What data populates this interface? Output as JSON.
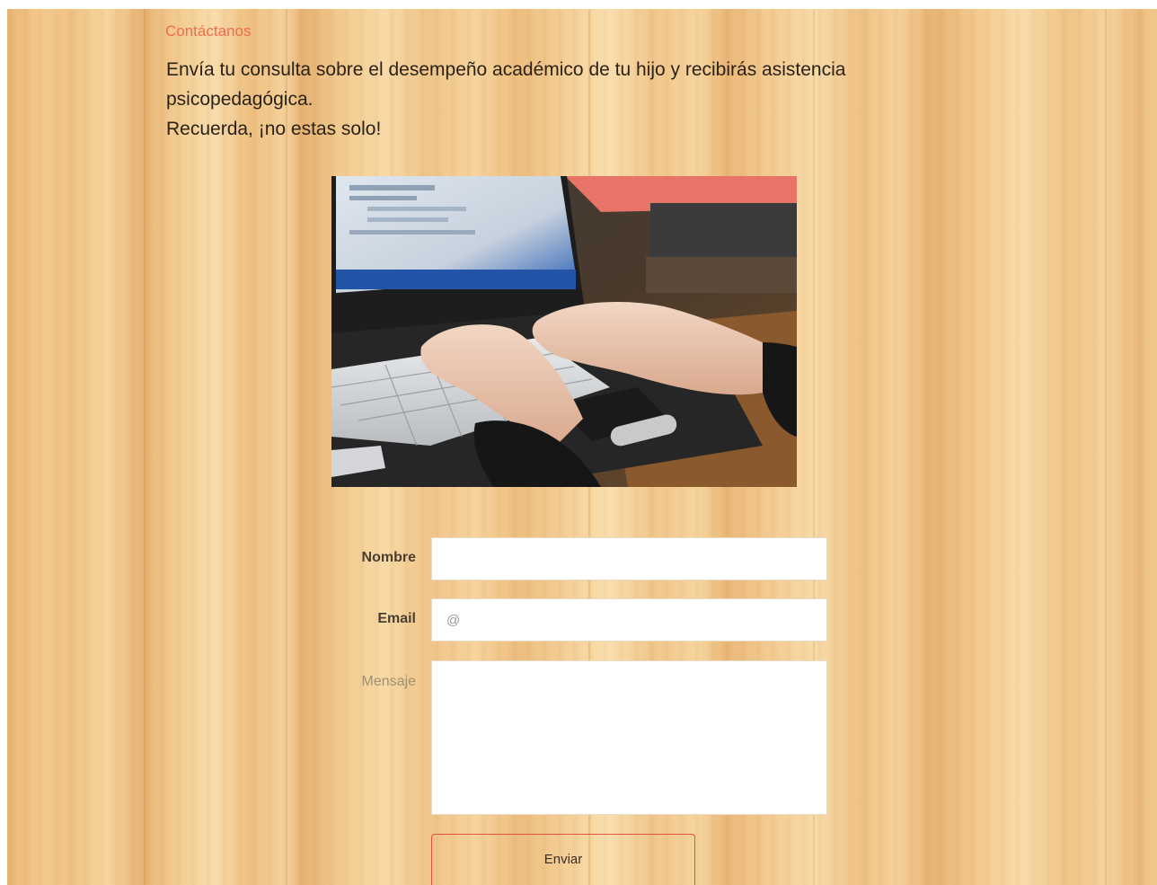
{
  "section": {
    "title": "Contáctanos",
    "intro_line1": "Envía tu consulta sobre el desempeño académico de tu hijo y recibirás asistencia",
    "intro_line2": "psicopedagógica.",
    "intro_line3": "Recuerda, ¡no estas solo!"
  },
  "image": {
    "subject": "hands typing on laptop keyboard"
  },
  "form": {
    "name_label": "Nombre",
    "name_value": "",
    "name_placeholder": "",
    "email_label": "Email",
    "email_value": "",
    "email_placeholder": "@",
    "message_label": "Mensaje",
    "message_value": "",
    "submit_label": "Enviar"
  },
  "colors": {
    "accent": "#f26a4b",
    "button_border": "#e4533a",
    "text_dark": "#2b2218",
    "background_wood": "#f2c88a"
  }
}
